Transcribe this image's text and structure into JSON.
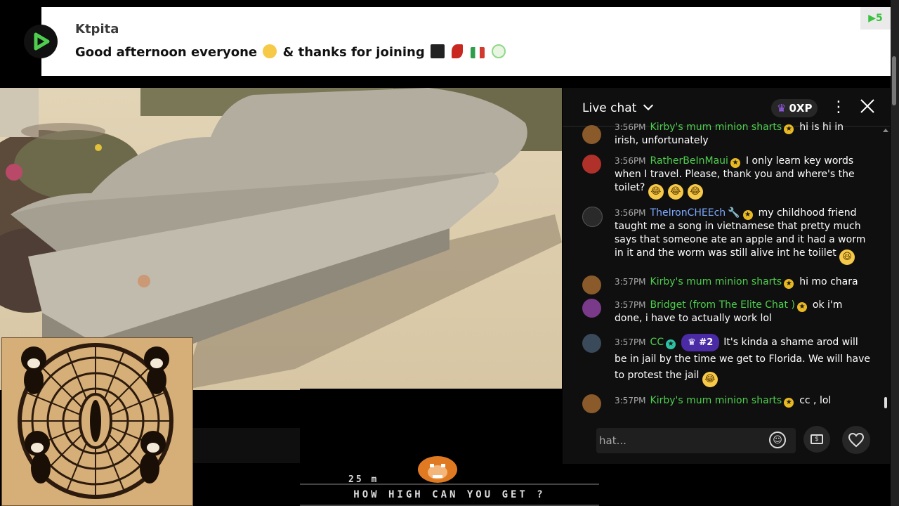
{
  "banner": {
    "username": "Ktpita",
    "message_part1": "Good afternoon everyone",
    "message_part2": "& thanks for joining",
    "corner_badge": "5"
  },
  "game": {
    "score_text": "25 m",
    "banner_text": "HOW HIGH CAN YOU GET ?"
  },
  "chat": {
    "title": "Live chat",
    "xp": "0XP",
    "input_placeholder": "hat...",
    "messages": [
      {
        "time": "3:56PM",
        "author": "Kirby's mum minion sharts",
        "text": "hi is hi in irish, unfortunately"
      },
      {
        "time": "3:56PM",
        "author": "RatherBeInMaui",
        "text": "I only learn key words when I travel. Please, thank you and where's the toilet?"
      },
      {
        "time": "3:56PM",
        "author": "TheIronCHEEch",
        "text": "my childhood friend taught me a song in vietnamese that pretty much says that someone ate an apple and it had a worm in it and the worm was still alive int he toiilet"
      },
      {
        "time": "3:57PM",
        "author": "Kirby's mum minion sharts",
        "text": "hi mo chara"
      },
      {
        "time": "3:57PM",
        "author": "Bridget (from The Elite Chat )",
        "text": "ok i'm done, i have to actually work lol"
      },
      {
        "time": "3:57PM",
        "author": "CC",
        "rank": "#2",
        "text": "It's kinda a shame arod will be in jail by the time we get to Florida. We will have to protest the jail"
      },
      {
        "time": "3:57PM",
        "author": "Kirby's mum minion sharts",
        "text": "cc , lol"
      }
    ]
  },
  "colors": {
    "author_green": "#4ece4e",
    "author_blue": "#7ea8ff",
    "rank_purple": "#4b2aa5",
    "member_star": "#e8b923",
    "logo_green": "#39c23e"
  }
}
